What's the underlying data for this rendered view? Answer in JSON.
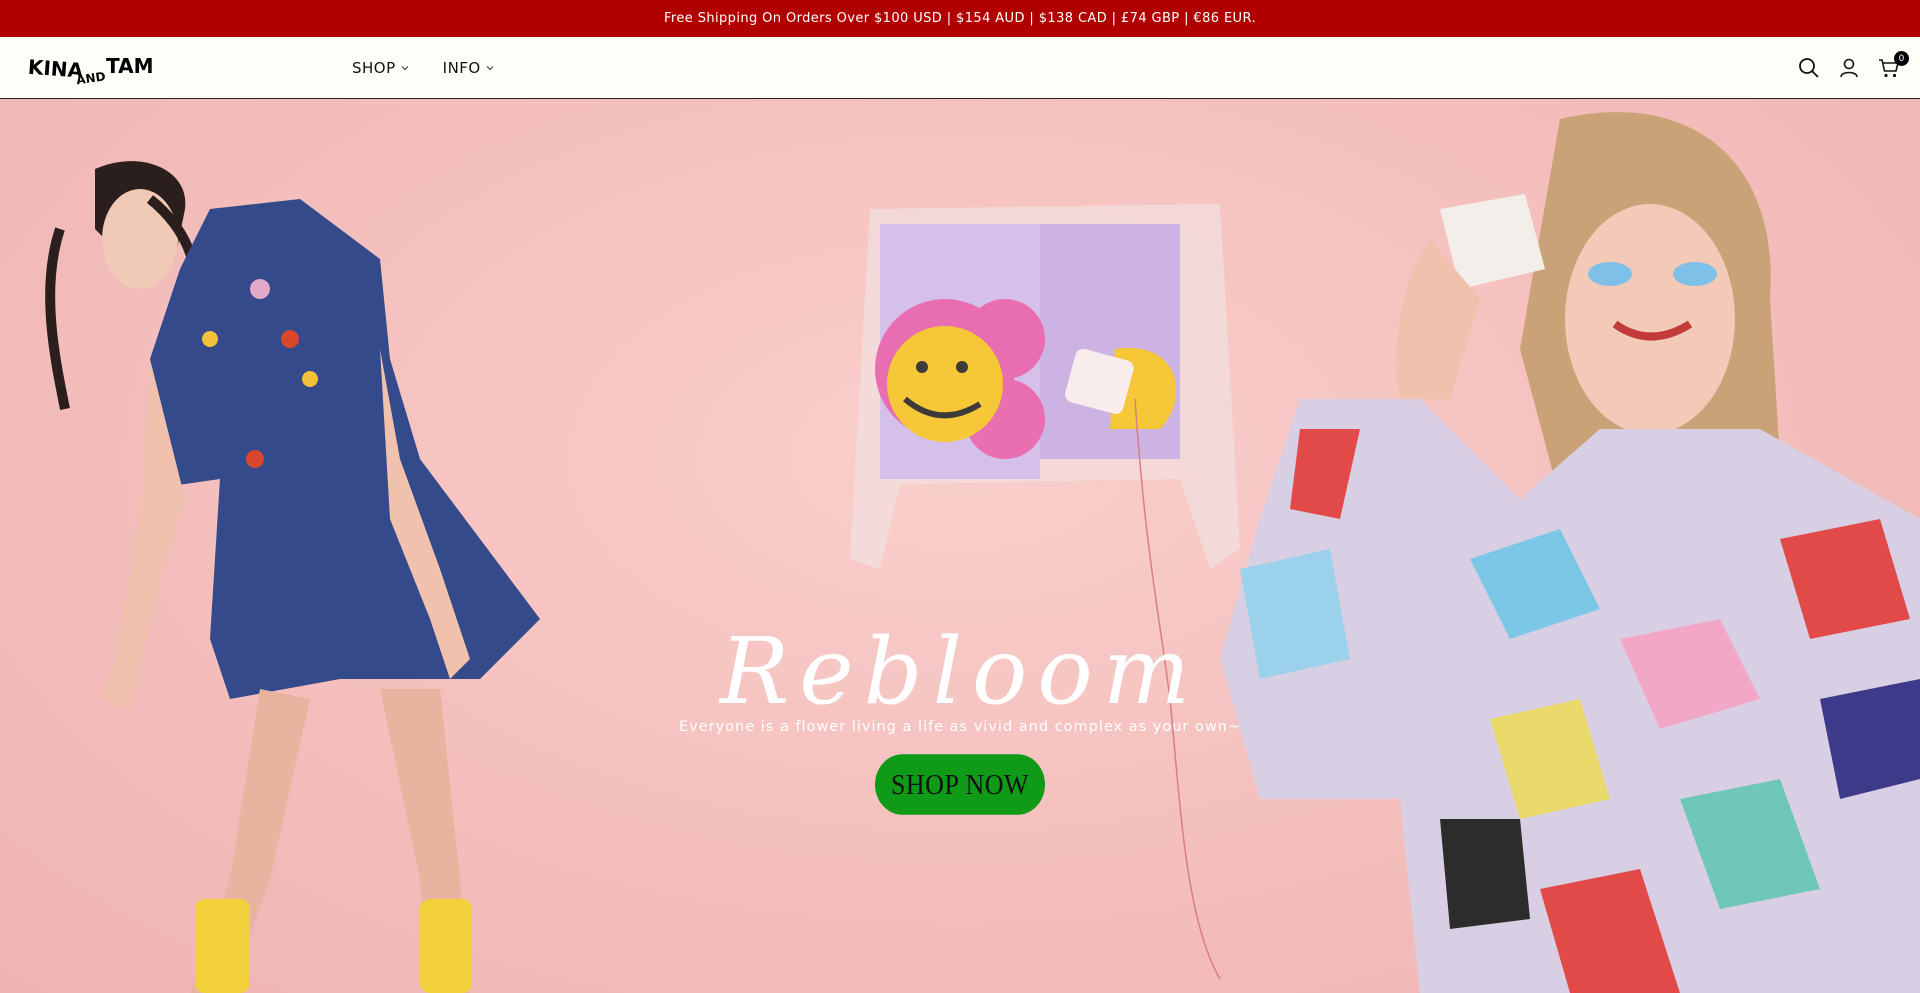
{
  "announcement": {
    "text": "Free Shipping On Orders Over $100 USD | $154 AUD | $138 CAD | £74 GBP | €86 EUR."
  },
  "header": {
    "logo_text": "KINA AND TAM",
    "nav": [
      {
        "label": "SHOP"
      },
      {
        "label": "INFO"
      }
    ],
    "cart_count": "0",
    "icons": [
      "search-icon",
      "account-icon",
      "cart-icon",
      "chevron-down-icon"
    ]
  },
  "hero": {
    "title": "Rebloom",
    "subtitle": "Everyone is a flower living a life as vivid and complex as your own~",
    "cta_label": "SHOP NOW"
  },
  "colors": {
    "announcement_bg": "#b00000",
    "header_bg": "#fffdf8",
    "hero_bg": "#f6c6c4",
    "cta_bg": "#0f9a18"
  }
}
